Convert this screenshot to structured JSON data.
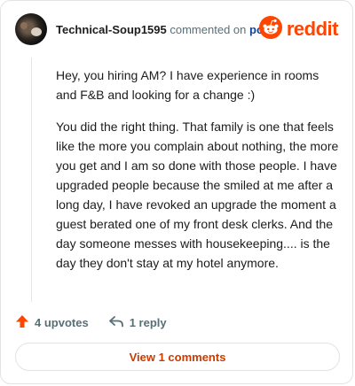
{
  "header": {
    "username": "Technical-Soup1595",
    "action_text": "commented on",
    "post_link": "post",
    "brand_name": "reddit",
    "brand_color": "#ff4500"
  },
  "comment": {
    "paragraphs": [
      "Hey, you hiring AM? I have experience in rooms and F&B and looking for a change :)",
      "You did the right thing. That family is one that feels like the more you complain about nothing, the more you get and I am so done with those people. I have upgraded people because the smiled at me after a long day, I have revoked an upgrade the moment a guest berated one of my front desk clerks. And the day someone messes with housekeeping.... is the day they don't stay at my hotel anymore."
    ]
  },
  "actions": {
    "upvotes_label": "4 upvotes",
    "reply_label": "1 reply",
    "upvote_icon": "arrow-up-icon",
    "reply_icon": "reply-arrow-icon"
  },
  "footer": {
    "view_comments_label": "View 1 comments"
  }
}
